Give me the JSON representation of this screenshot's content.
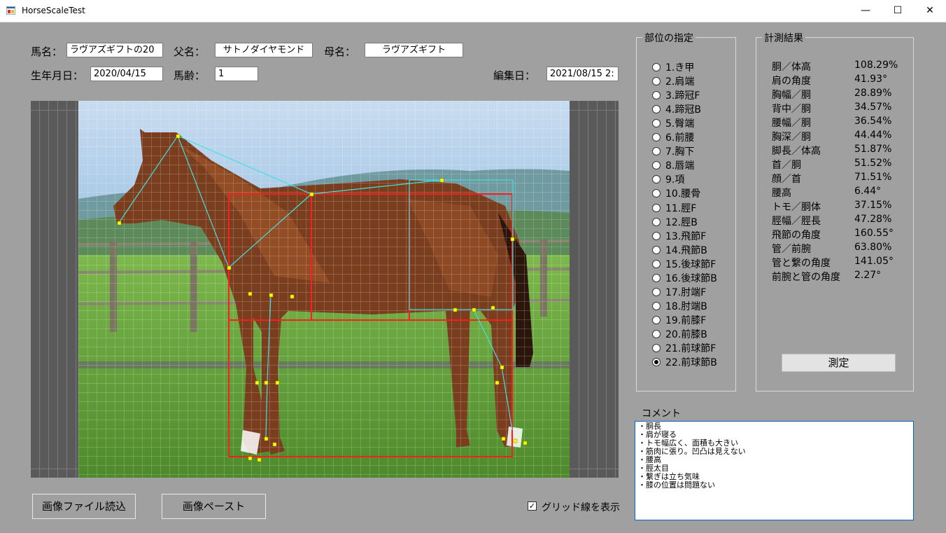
{
  "window": {
    "title": "HorseScaleTest",
    "minimize": "—",
    "maximize": "☐",
    "close": "✕"
  },
  "fields": {
    "horse_name_label": "馬名：",
    "horse_name": "ラヴアズギフトの20",
    "sire_label": "父名：",
    "sire": "サトノダイヤモンド",
    "dam_label": "母名：",
    "dam": "ラヴアズギフト",
    "birth_label": "生年月日：",
    "birth": "2020/04/15",
    "age_label": "馬齢：",
    "age": "1",
    "edit_label": "編集日：",
    "edit_date": "2021/08/15 2:"
  },
  "parts": {
    "title": "部位の指定",
    "items": [
      "1.き甲",
      "2.肩端",
      "3.蹄冠F",
      "4.蹄冠B",
      "5.臀端",
      "6.前腰",
      "7.胸下",
      "8.唇端",
      "9.項",
      "10.腰骨",
      "11.脛F",
      "12.脛B",
      "13.飛節F",
      "14.飛節B",
      "15.後球節F",
      "16.後球節B",
      "17.肘端F",
      "18.肘端B",
      "19.前膝F",
      "20.前膝B",
      "21.前球節F",
      "22.前球節B"
    ],
    "selected": 21
  },
  "results": {
    "title": "計測結果",
    "rows": [
      {
        "label": "胴／体高",
        "value": "108.29%"
      },
      {
        "label": "肩の角度",
        "value": "41.93°"
      },
      {
        "label": "胸幅／胴",
        "value": "28.89%"
      },
      {
        "label": "背中／胴",
        "value": "34.57%"
      },
      {
        "label": "腰幅／胴",
        "value": "36.54%"
      },
      {
        "label": "胸深／胴",
        "value": "44.44%"
      },
      {
        "label": "脚長／体高",
        "value": "51.87%"
      },
      {
        "label": "首／胴",
        "value": "51.52%"
      },
      {
        "label": "顔／首",
        "value": "71.51%"
      },
      {
        "label": "腰高",
        "value": "6.44°"
      },
      {
        "label": "トモ／胴体",
        "value": "37.15%"
      },
      {
        "label": "脛幅／脛長",
        "value": "47.28%"
      },
      {
        "label": "飛節の角度",
        "value": "160.55°"
      },
      {
        "label": "管／前腕",
        "value": "63.80%"
      },
      {
        "label": "管と繋の角度",
        "value": "141.05°"
      },
      {
        "label": "前腕と管の角度",
        "value": "2.27°"
      }
    ],
    "measure_button": "測定"
  },
  "comment": {
    "label": "コメント",
    "lines": [
      "・胴長",
      "・肩が寝る",
      "・トモ幅広く、面積も大きい",
      "・筋肉に張り。凹凸は見えない",
      "・腰高",
      "・脛太目",
      "・繋ぎは立ち気味",
      "・膝の位置は問題ない"
    ]
  },
  "buttons": {
    "load_image": "画像ファイル読込",
    "paste_image": "画像ペースト"
  },
  "grid_checkbox": {
    "label": "グリッド線を表示",
    "checked": true,
    "mark": "✓"
  },
  "colors": {
    "overlay_line": "#40e0e0",
    "overlay_box": "#ff1e1e",
    "point": "#ffff00",
    "background": "#a0a0a0"
  }
}
